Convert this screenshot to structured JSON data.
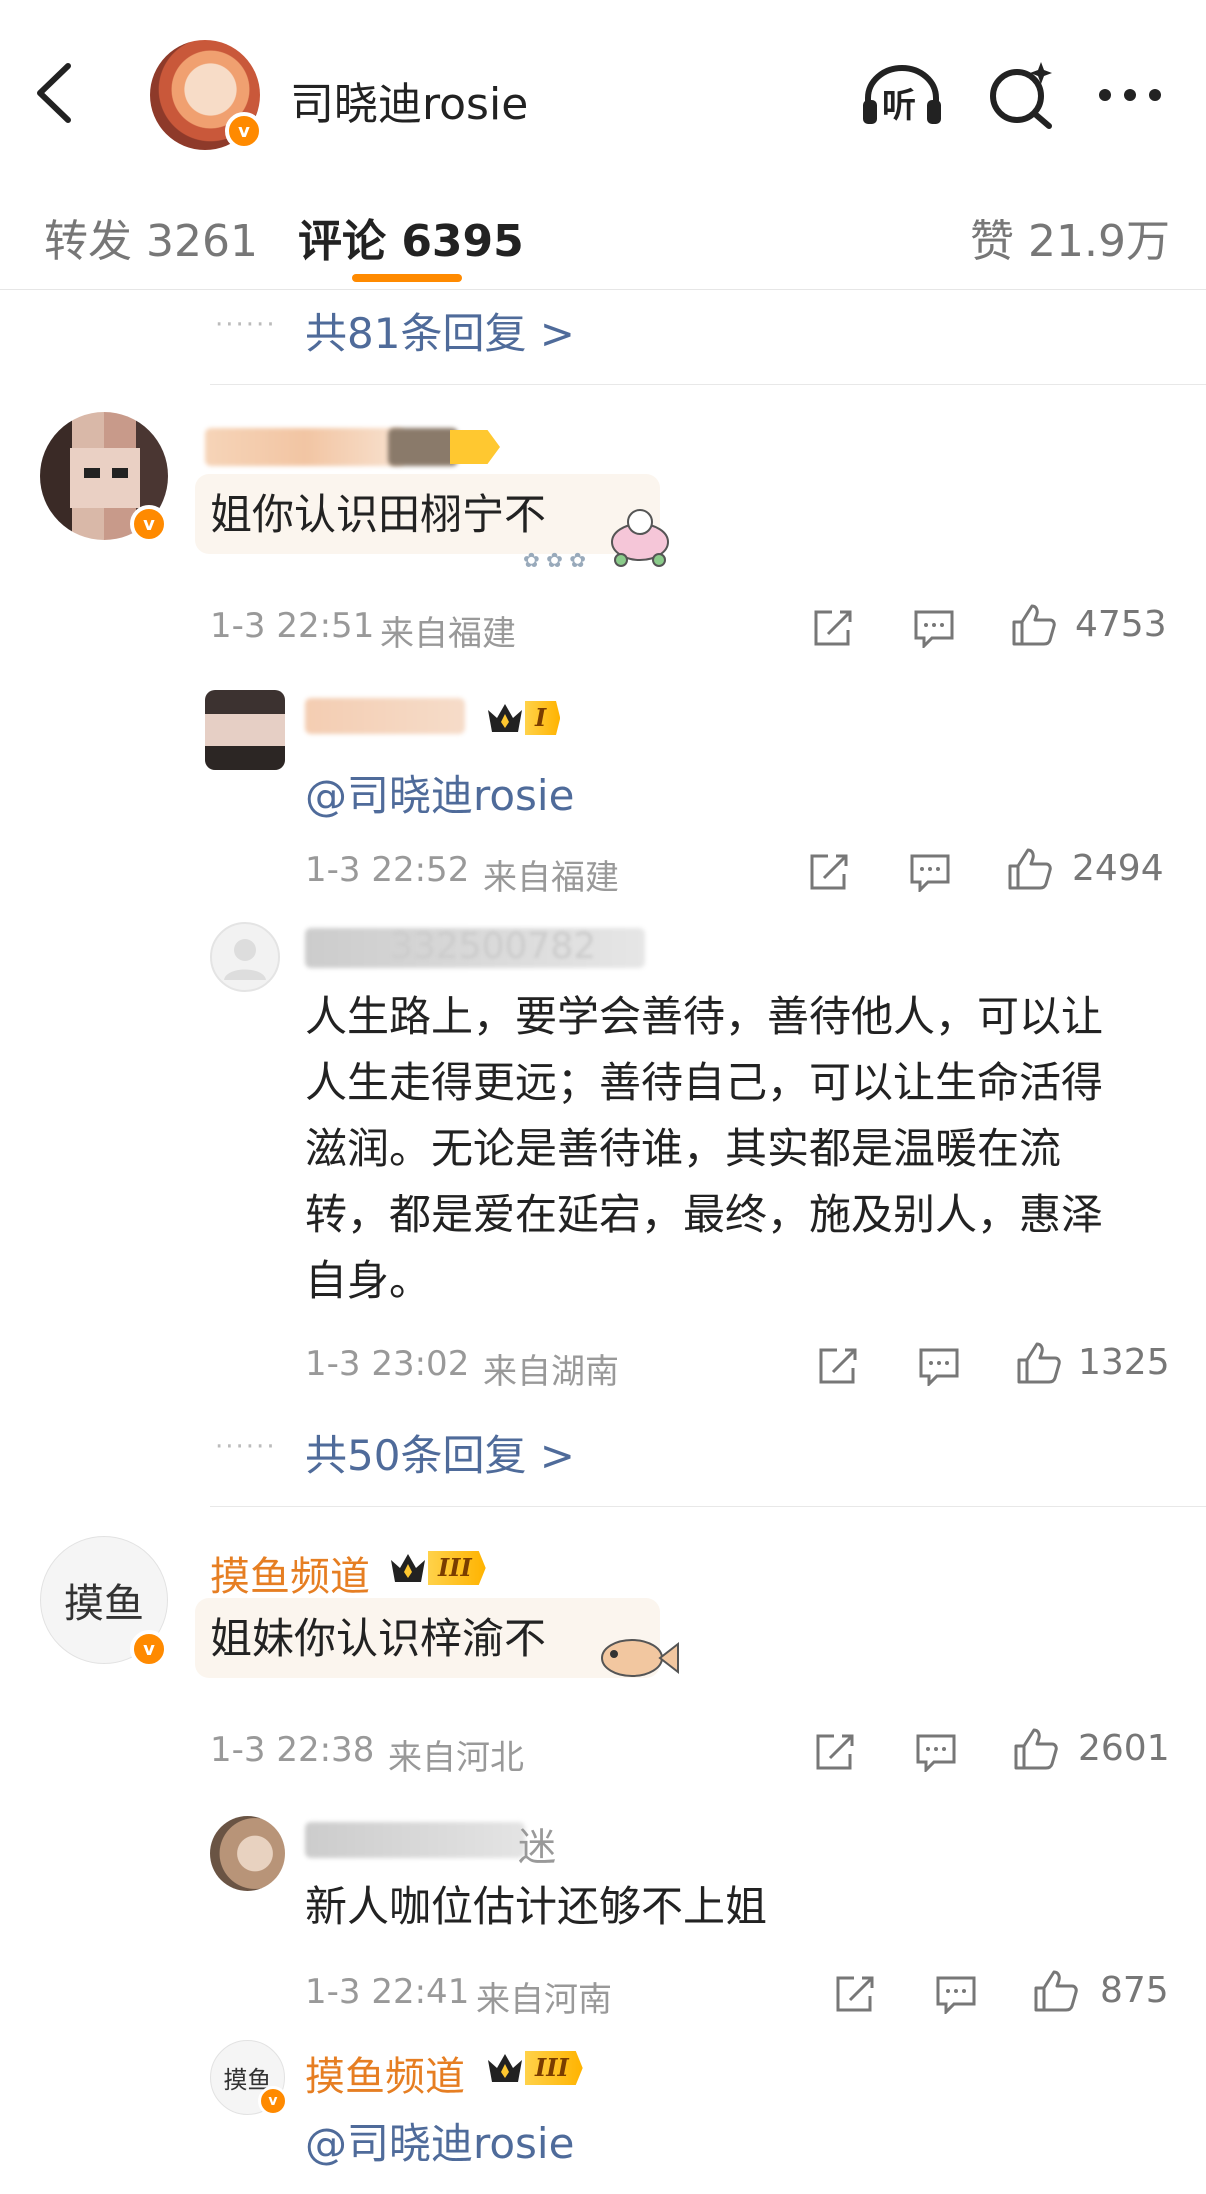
{
  "header": {
    "username": "司晓迪rosie",
    "verified_badge": "v",
    "icons": [
      "back-arrow-icon",
      "listen-icon",
      "ai-search-icon",
      "more-icon"
    ],
    "listen_label": "听"
  },
  "tabs": [
    {
      "label": "转发 3261"
    },
    {
      "label": "评论 6395"
    },
    {
      "label": "赞 21.9万"
    }
  ],
  "threads": [
    {
      "more_replies_top": "共81条回复 >",
      "comment": {
        "text": "姐你认识田栩宁不",
        "time": "1-3 22:51",
        "location": "来自福建",
        "likes": "4753"
      },
      "replies": [
        {
          "level": "I",
          "text": "@司晓迪rosie",
          "time": "1-3 22:52",
          "location": "来自福建",
          "likes": "2494"
        },
        {
          "name_partial": "332500782",
          "text": "人生路上，要学会善待，善待他人，可以让人生走得更远；善待自己，可以让生命活得滋润。无论是善待谁，其实都是温暖在流转，都是爱在延宕，最终，施及别人，惠泽自身。",
          "lines": [
            "人生路上，要学会善待，善待他人，可以让",
            "人生走得更远；善待自己，可以让生命活得",
            "滋润。无论是善待谁，其实都是温暖在流",
            "转，都是爱在延宕，最终，施及别人，惠泽",
            "自身。"
          ],
          "time": "1-3 23:02",
          "location": "来自湖南",
          "likes": "1325"
        }
      ],
      "more_replies": "共50条回复 >"
    },
    {
      "comment": {
        "name": "摸鱼频道",
        "avatar_text": "摸鱼",
        "level": "III",
        "text": "姐妹你认识梓渝不",
        "time": "1-3 22:38",
        "location": "来自河北",
        "likes": "2601"
      },
      "replies": [
        {
          "name_partial": "迷",
          "text": "新人咖位估计还够不上姐",
          "time": "1-3 22:41",
          "location": "来自河南",
          "likes": "875"
        },
        {
          "name": "摸鱼频道",
          "level": "III",
          "text": "@司晓迪rosie"
        }
      ]
    }
  ],
  "colors": {
    "accent": "#ff8a00",
    "link": "#4f6b9a",
    "orange_name": "#e67e22"
  }
}
